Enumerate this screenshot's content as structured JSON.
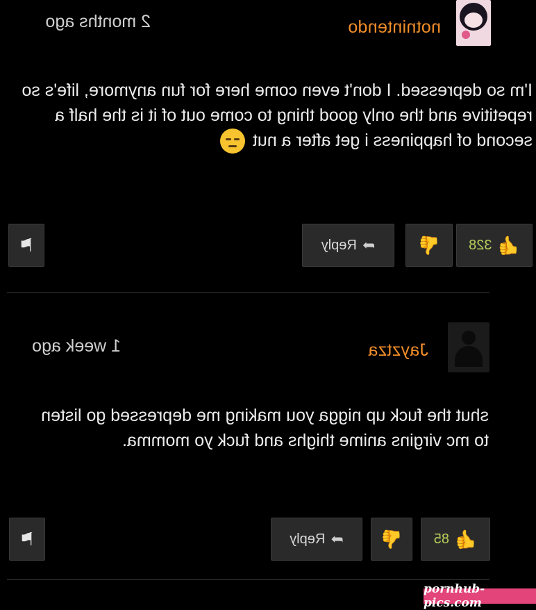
{
  "comments": [
    {
      "username": "notnintendo",
      "time": "2 months ago",
      "text": "I'm so depressed. I don't even come here for fun anymore, life's so repetitive and the only good thing to come out of it is the half a second of happiness i get after a nut",
      "emoji": "pensive-face",
      "likes": "328",
      "reply_label": "Reply"
    },
    {
      "username": "Jayztza",
      "time": "1 week ago",
      "text": "shut the fuck up nigga you making me depressed go listen to mc virgins anime thighs and fuck yo momma.",
      "likes": "85",
      "reply_label": "Reply"
    }
  ],
  "watermark": "pornhub-pics.com",
  "colors": {
    "username": "#f08c2a",
    "like_count": "#b8cf5a",
    "watermark_bg": "#e3457a"
  }
}
